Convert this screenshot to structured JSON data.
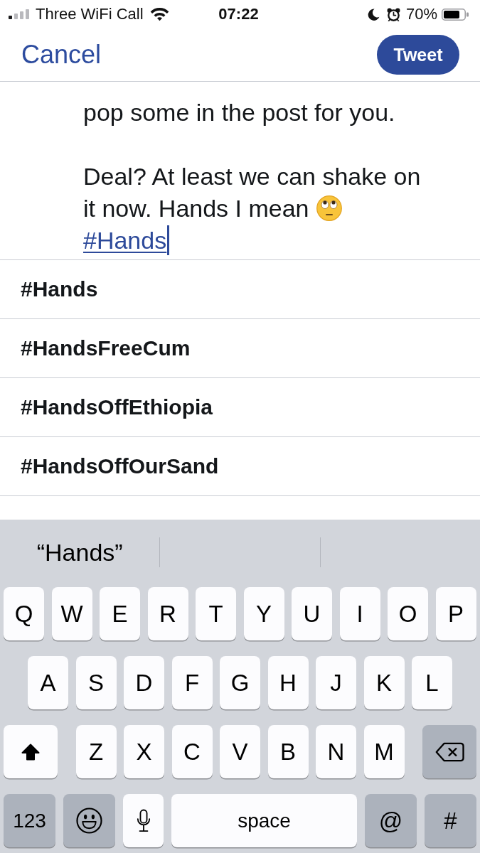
{
  "status_bar": {
    "carrier": "Three WiFi Call",
    "time": "07:22",
    "battery": "70%"
  },
  "header": {
    "cancel": "Cancel",
    "tweet": "Tweet"
  },
  "compose": {
    "paragraphs": [
      [
        "pop some in the post for you."
      ],
      [
        "Deal? At least we can shake on",
        "it now. Hands I mean"
      ]
    ],
    "hashtag": "#Hands"
  },
  "suggestions": [
    "#Hands",
    "#HandsFreeCum",
    "#HandsOffEthiopia",
    "#HandsOffOurSand"
  ],
  "keyboard": {
    "predictions": [
      "“Hands”"
    ],
    "rows": [
      [
        "Q",
        "W",
        "E",
        "R",
        "T",
        "Y",
        "U",
        "I",
        "O",
        "P"
      ],
      [
        "A",
        "S",
        "D",
        "F",
        "G",
        "H",
        "J",
        "K",
        "L"
      ],
      [
        "Z",
        "X",
        "C",
        "V",
        "B",
        "N",
        "M"
      ]
    ],
    "shift_on": true,
    "bottom_row": [
      {
        "kind": "mode",
        "label": "123"
      },
      {
        "kind": "emoji"
      },
      {
        "kind": "dictation"
      },
      {
        "kind": "space",
        "label": "space"
      },
      {
        "kind": "symbol",
        "label": "@"
      },
      {
        "kind": "symbol",
        "label": "#"
      }
    ]
  }
}
